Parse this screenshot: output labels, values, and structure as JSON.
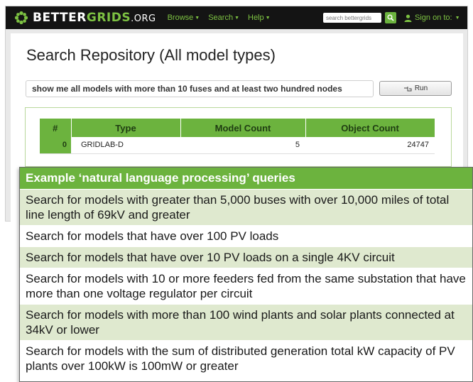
{
  "navbar": {
    "brand": {
      "part1": "BETTER",
      "part2": "GRIDS",
      "part3": ".ORG"
    },
    "links": [
      "Browse",
      "Search",
      "Help"
    ],
    "search_placeholder": "search bettergrids",
    "sign_in": "Sign on to:",
    "logo_icon": "grid-flower-logo",
    "search_icon": "magnifier-icon",
    "user_icon": "person-icon"
  },
  "page": {
    "title": "Search Repository (All model types)",
    "query_value": "show me all models with more than 10 fuses and at least two hundred nodes",
    "run_label": "Run",
    "run_icon": "hand-pointer-icon"
  },
  "results": {
    "headers": [
      "#",
      "Type",
      "Model Count",
      "Object Count"
    ],
    "rows": [
      {
        "index": "0",
        "type": "GRIDLAB-D",
        "model_count": "5",
        "object_count": "24747"
      }
    ]
  },
  "examples": {
    "header": "Example ‘natural language processing’ queries",
    "items": [
      "Search for models with greater than 5,000 buses with over 10,000 miles of total line length of 69kV and greater",
      "Search for models that have over 100 PV loads",
      "Search for models that have over 10 PV loads on a single 4KV circuit",
      "Search for models with 10 or more feeders fed from the same substation that have more than one voltage regulator per circuit",
      "Search for models with more than 100 wind plants and solar plants connected at 34kV or lower",
      "Search for models with the sum of distributed generation total kW capacity of PV plants over 100kW is 100mW or greater"
    ]
  },
  "colors": {
    "accent_green": "#6cb33e",
    "brand_green": "#7dc242",
    "navbar_bg": "#141414",
    "row_tint": "#dfe9cf"
  }
}
